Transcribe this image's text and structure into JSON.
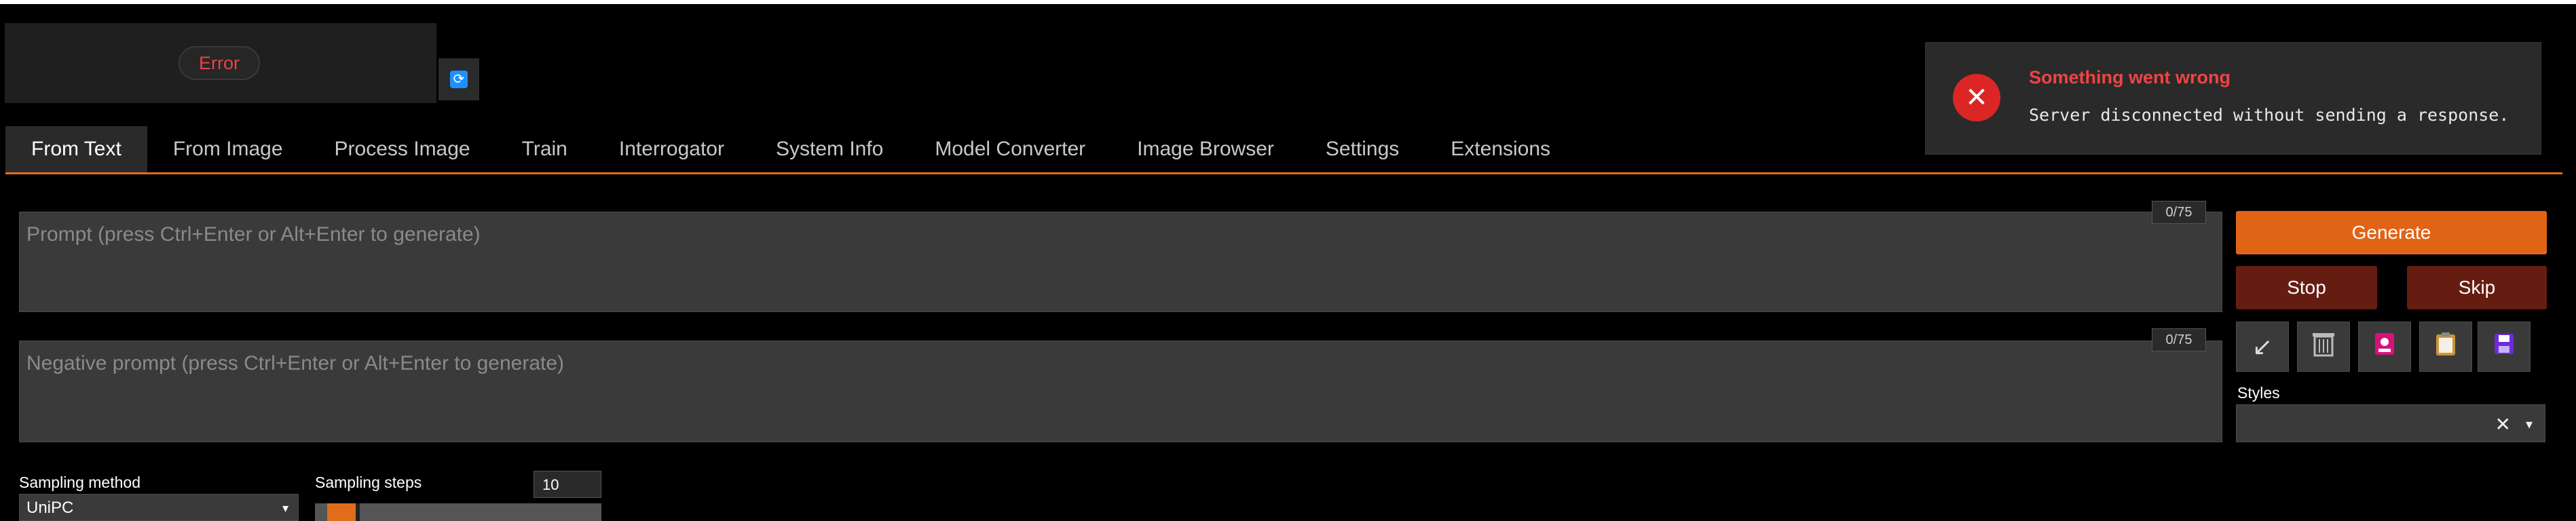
{
  "model": {
    "status_label": "Error",
    "refresh_icon": "refresh-icon"
  },
  "toast": {
    "icon": "close-circle-icon",
    "title": "Something went wrong",
    "message": "Server disconnected without sending a response."
  },
  "tabs": [
    {
      "label": "From Text",
      "active": true
    },
    {
      "label": "From Image"
    },
    {
      "label": "Process Image"
    },
    {
      "label": "Train"
    },
    {
      "label": "Interrogator"
    },
    {
      "label": "System Info"
    },
    {
      "label": "Model Converter"
    },
    {
      "label": "Image Browser"
    },
    {
      "label": "Settings"
    },
    {
      "label": "Extensions"
    }
  ],
  "prompt": {
    "placeholder": "Prompt (press Ctrl+Enter or Alt+Enter to generate)",
    "counter": "0/75"
  },
  "negative_prompt": {
    "placeholder": "Negative prompt (press Ctrl+Enter or Alt+Enter to generate)",
    "counter": "0/75"
  },
  "actions": {
    "generate_label": "Generate",
    "stop_label": "Stop",
    "skip_label": "Skip",
    "tool_icons": [
      "arrow-down-left-icon",
      "trash-icon",
      "image-icon",
      "clipboard-icon",
      "save-icon"
    ]
  },
  "styles": {
    "label": "Styles",
    "value": ""
  },
  "sampling": {
    "method_label": "Sampling method",
    "method_value": "UniPC",
    "steps_label": "Sampling steps",
    "steps_value": "10",
    "steps_fraction": 0.1
  },
  "colors": {
    "accent": "#e06c1c",
    "generate": "#e16416",
    "stop": "#651d12",
    "error": "#ef4444"
  }
}
